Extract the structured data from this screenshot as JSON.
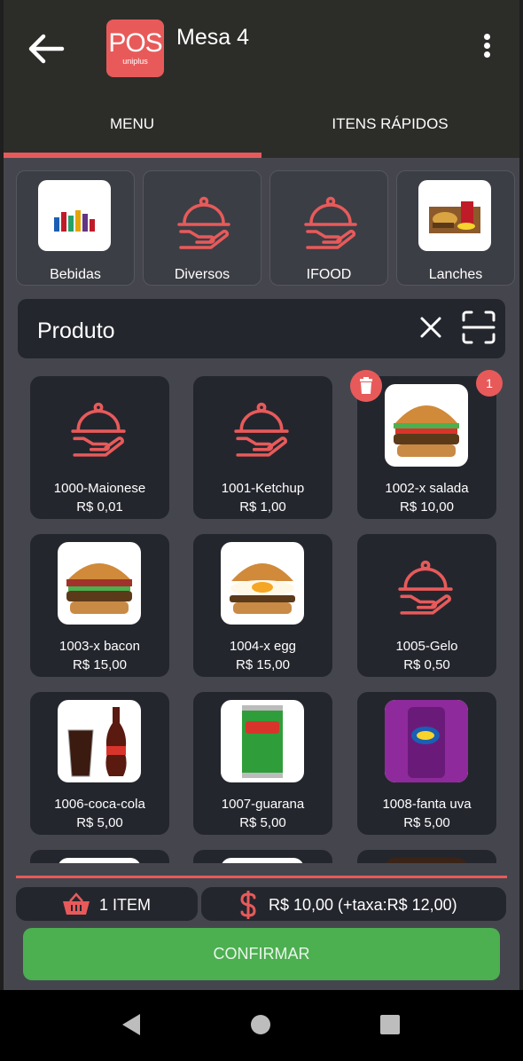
{
  "appbar": {
    "title": "Mesa 4",
    "logo_main": "POS",
    "logo_sub": "uniplus"
  },
  "tabs": [
    {
      "label": "MENU"
    },
    {
      "label": "ITENS RÁPIDOS"
    }
  ],
  "categories": [
    {
      "label": "Bebidas"
    },
    {
      "label": "Diversos"
    },
    {
      "label": "IFOOD"
    },
    {
      "label": "Lanches"
    }
  ],
  "search": {
    "placeholder": "Produto"
  },
  "products": [
    {
      "name": "1000-Maionese",
      "price": "R$ 0,01"
    },
    {
      "name": "1001-Ketchup",
      "price": "R$ 1,00"
    },
    {
      "name": "1002-x salada",
      "price": "R$ 10,00"
    },
    {
      "name": "1003-x bacon",
      "price": "R$ 15,00"
    },
    {
      "name": "1004-x egg",
      "price": "R$ 15,00"
    },
    {
      "name": "1005-Gelo",
      "price": "R$ 0,50"
    },
    {
      "name": "1006-coca-cola",
      "price": "R$ 5,00"
    },
    {
      "name": "1007-guarana",
      "price": "R$ 5,00"
    },
    {
      "name": "1008-fanta uva",
      "price": "R$ 5,00"
    }
  ],
  "selected_badge": "1",
  "footer": {
    "items_label": "1 ITEM",
    "total_label": "R$ 10,00 (+taxa:R$ 12,00)",
    "confirm_label": "CONFIRMAR"
  },
  "colors": {
    "accent": "#e85a5a",
    "confirm": "#4caf50",
    "background": "#45464d",
    "card": "#24262e",
    "appbar": "#2c2d29"
  }
}
